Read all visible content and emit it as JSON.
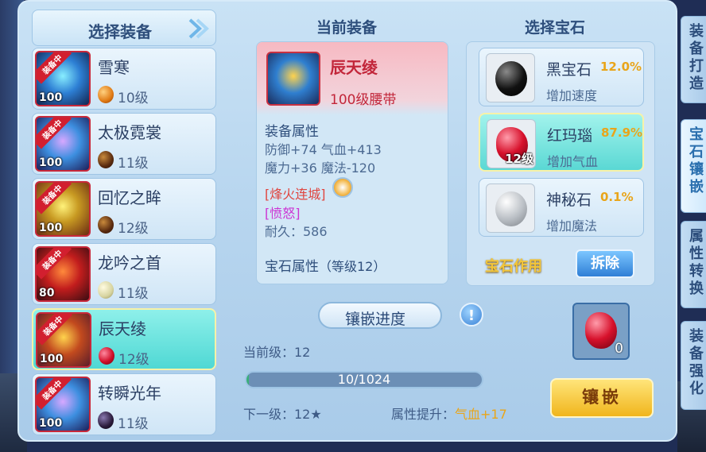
{
  "left": {
    "header": "选择装备",
    "items": [
      {
        "badge": "装备中",
        "level": "100",
        "name": "雪寒",
        "gem_level": "10级",
        "gem_color": "or",
        "thumb": "b"
      },
      {
        "badge": "装备中",
        "level": "100",
        "name": "太极霓裳",
        "gem_level": "11级",
        "gem_color": "br",
        "thumb": "e"
      },
      {
        "badge": "装备中",
        "level": "100",
        "name": "回忆之眸",
        "gem_level": "12级",
        "gem_color": "br",
        "thumb": "c"
      },
      {
        "badge": "装备中",
        "level": "80",
        "name": "龙吟之首",
        "gem_level": "11级",
        "gem_color": "pa",
        "thumb": "d"
      },
      {
        "badge": "装备中",
        "level": "100",
        "name": "辰天绫",
        "gem_level": "12级",
        "gem_color": "rd",
        "thumb": "a"
      },
      {
        "badge": "装备中",
        "level": "100",
        "name": "转瞬光年",
        "gem_level": "11级",
        "gem_color": "bk",
        "thumb": "e"
      }
    ]
  },
  "middle": {
    "title": "当前装备",
    "equip_name": "辰天绫",
    "equip_sub": "100级腰带",
    "attr_title": "装备属性",
    "attr_line1": "防御+74 气血+413",
    "attr_line2": "魔力+36 魔法-120",
    "special1": "[烽火连城]",
    "special2": "[愤怒]",
    "durability": "耐久：586",
    "gem_attr_title": "宝石属性",
    "gem_attr_level": "（等级12）",
    "progress_title": "镶嵌进度",
    "info_icon": "!",
    "current_level": "当前级：12",
    "progress_text": "10/1024",
    "progress_fraction": 0.0098,
    "next_level": "下一级：12★",
    "attr_boost_label": "属性提升：",
    "attr_boost_value": "气血+17"
  },
  "right": {
    "title": "选择宝石",
    "gems": [
      {
        "name": "黑宝石",
        "pct": "12.0%",
        "desc": "增加速度",
        "stone": "black",
        "lvl": ""
      },
      {
        "name": "红玛瑙",
        "pct": "87.9%",
        "desc": "增加气血",
        "stone": "red",
        "lvl": "12级"
      },
      {
        "name": "神秘石",
        "pct": "0.1%",
        "desc": "增加魔法",
        "stone": "silver",
        "lvl": ""
      }
    ],
    "effect_label": "宝石作用",
    "remove_button": "拆除",
    "slot_count": "0",
    "inlay_button": "镶嵌"
  },
  "tabs": [
    {
      "label": "装备打造"
    },
    {
      "label": "宝石镶嵌"
    },
    {
      "label": "属性转换"
    },
    {
      "label": "装备强化"
    }
  ]
}
